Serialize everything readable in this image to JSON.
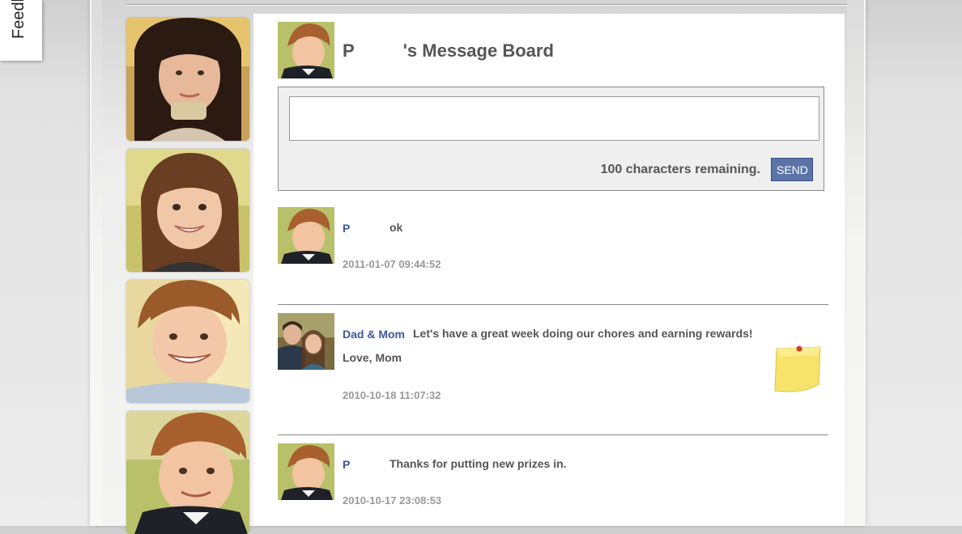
{
  "feedback": {
    "label": "Feedback"
  },
  "sidebar": {
    "photos": [
      {
        "name": "photo-girl-teen"
      },
      {
        "name": "photo-girl"
      },
      {
        "name": "photo-boy-smiling"
      },
      {
        "name": "photo-boy-jacket"
      }
    ]
  },
  "board": {
    "owner_initial": "P",
    "title_suffix": "'s Message Board"
  },
  "compose": {
    "placeholder": "",
    "remaining_text": "100 characters remaining.",
    "send_label": "SEND"
  },
  "posts": [
    {
      "author": "P",
      "message": "ok",
      "timestamp": "2011-01-07 09:44:52"
    },
    {
      "author": "Dad & Mom",
      "message": "Let's have a great week doing our chores and earning rewards! Love, Mom",
      "timestamp": "2010-10-18 11:07:32"
    },
    {
      "author": "P",
      "message": "Thanks for putting new prizes in.",
      "timestamp": "2010-10-17 23:08:53"
    }
  ],
  "colors": {
    "accent": "#3b5998",
    "send_button": "#5b74a8",
    "timestamp": "#999999"
  }
}
